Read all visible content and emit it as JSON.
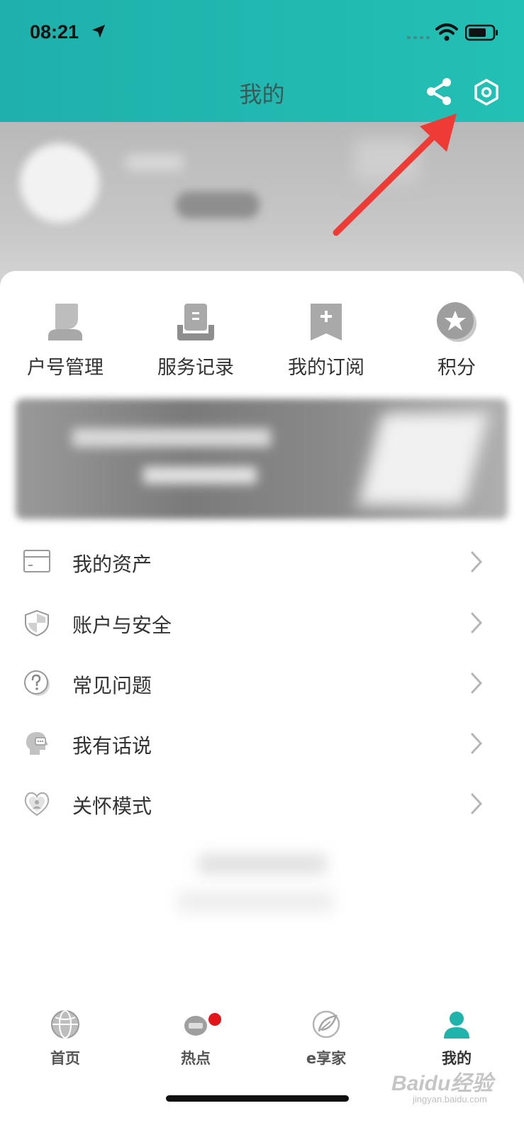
{
  "status_bar": {
    "time": "08:21"
  },
  "header": {
    "title": "我的"
  },
  "quick_actions": [
    {
      "label": "户号管理",
      "icon": "person-card-icon"
    },
    {
      "label": "服务记录",
      "icon": "service-record-icon"
    },
    {
      "label": "我的订阅",
      "icon": "bookmark-plus-icon"
    },
    {
      "label": "积分",
      "icon": "star-badge-icon"
    }
  ],
  "menu": [
    {
      "label": "我的资产",
      "icon": "card-asset-icon"
    },
    {
      "label": "账户与安全",
      "icon": "shield-icon"
    },
    {
      "label": "常见问题",
      "icon": "question-icon"
    },
    {
      "label": "我有话说",
      "icon": "speak-head-icon"
    },
    {
      "label": "关怀模式",
      "icon": "heart-care-icon"
    }
  ],
  "tabbar": [
    {
      "label": "首页",
      "icon": "globe-icon",
      "active": false
    },
    {
      "label": "热点",
      "icon": "hot-icon",
      "active": false,
      "badge": true
    },
    {
      "label": "e享家",
      "icon": "leaf-icon",
      "active": false
    },
    {
      "label": "我的",
      "icon": "user-icon",
      "active": true
    }
  ],
  "watermark": {
    "main": "Baidu经验",
    "sub": "jingyan.baidu.com"
  },
  "colors": {
    "header": "#22c0b5",
    "active_tab": "#1fb3ab",
    "badge": "#e4141b",
    "annotation_arrow": "#ee3b35"
  }
}
